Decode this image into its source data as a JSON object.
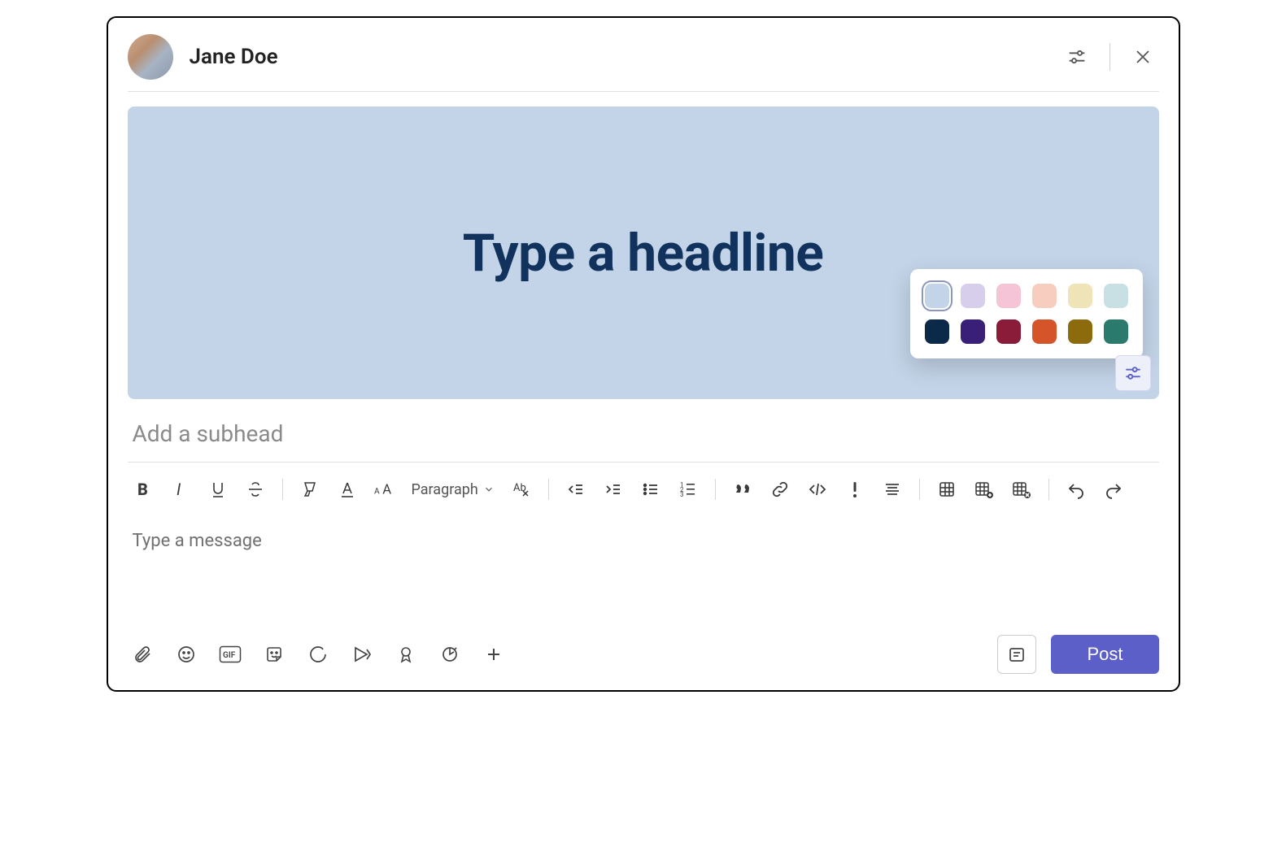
{
  "header": {
    "author": "Jane Doe"
  },
  "banner": {
    "headline_placeholder": "Type a headline",
    "background_color": "#c3d4e8",
    "palette_light": [
      "#c3d4e8",
      "#d6ceeb",
      "#f5c4d6",
      "#f6cdbe",
      "#efe3b8",
      "#c8dfe3"
    ],
    "palette_dark": [
      "#0b2a4a",
      "#3a1f78",
      "#8a1c3a",
      "#d6542a",
      "#8c6b0d",
      "#2a7a6d"
    ],
    "selected_index": 0
  },
  "subhead_placeholder": "Add a subhead",
  "toolbar": {
    "paragraph_label": "Paragraph"
  },
  "message_placeholder": "Type a message",
  "footer": {
    "post_label": "Post"
  }
}
